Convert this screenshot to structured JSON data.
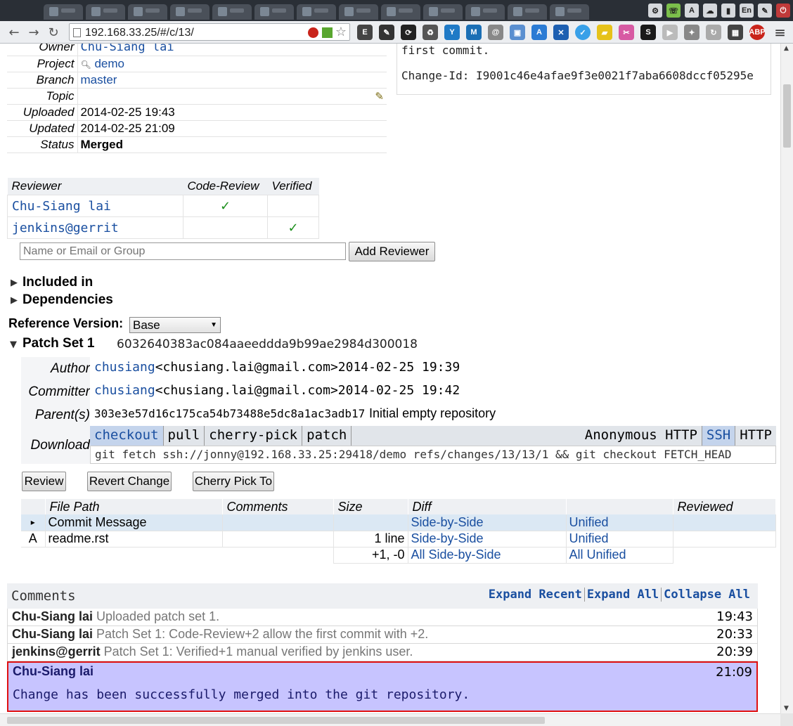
{
  "browser": {
    "url": "192.168.33.25/#/c/13/",
    "tray_labels": [
      "A",
      "En"
    ]
  },
  "change_info": {
    "rows": [
      {
        "label": "Owner",
        "value": "Chu-Siang lai",
        "link": true,
        "mono": true
      },
      {
        "label": "Project",
        "value": "demo",
        "link": true,
        "mono": false,
        "search_icon": true
      },
      {
        "label": "Branch",
        "value": "master",
        "link": true,
        "mono": false
      },
      {
        "label": "Topic",
        "value": "",
        "link": false,
        "mono": false,
        "edit_icon": true
      },
      {
        "label": "Uploaded",
        "value": "2014-02-25 19:43",
        "link": false,
        "mono": false
      },
      {
        "label": "Updated",
        "value": "2014-02-25 21:09",
        "link": false,
        "mono": false
      },
      {
        "label": "Status",
        "value": "Merged",
        "link": false,
        "mono": false,
        "bold": true
      }
    ]
  },
  "commit_message": {
    "first_line": "first commit.",
    "change_id": "Change-Id: I9001c46e4afae9f3e0021f7aba6608dccf05295e"
  },
  "reviewers": {
    "headers": [
      "Reviewer",
      "Code-Review",
      "Verified"
    ],
    "rows": [
      {
        "name": "Chu-Siang lai",
        "code_review": "✓",
        "verified": ""
      },
      {
        "name": "jenkins@gerrit",
        "code_review": "",
        "verified": "✓"
      }
    ],
    "input_placeholder": "Name or Email or Group",
    "add_button": "Add Reviewer"
  },
  "sections": {
    "included_in": "Included in",
    "dependencies": "Dependencies",
    "reference_version_label": "Reference Version:",
    "reference_version_value": "Base"
  },
  "patch_set": {
    "title": "Patch Set 1",
    "revision": "6032640383ac084aaeeddda9b99ae2984d300018",
    "author_label": "Author",
    "author_name": "chusiang",
    "author_email": "<chusiang.lai@gmail.com>",
    "author_date": "2014-02-25 19:39",
    "committer_label": "Committer",
    "committer_name": "chusiang",
    "committer_email": "<chusiang.lai@gmail.com>",
    "committer_date": "2014-02-25 19:42",
    "parent_label": "Parent(s)",
    "parent_hash": "303e3e57d16c175ca54b73488e5dc8a1ac3adb17",
    "parent_subject": "Initial empty repository",
    "download_label": "Download",
    "download_tabs": [
      "checkout",
      "pull",
      "cherry-pick",
      "patch"
    ],
    "transport_tabs": [
      "Anonymous HTTP",
      "SSH",
      "HTTP"
    ],
    "download_command": "git fetch ssh://jonny@192.168.33.25:29418/demo refs/changes/13/13/1 && git checkout FETCH_HEAD",
    "actions": [
      "Review",
      "Revert Change",
      "Cherry Pick To"
    ]
  },
  "files": {
    "headers": [
      "File Path",
      "Comments",
      "Size",
      "Diff",
      "",
      "Reviewed"
    ],
    "rows": [
      {
        "mark": "▸",
        "path": "Commit Message",
        "comments": "",
        "size": "",
        "sbs": "Side-by-Side",
        "unified": "Unified"
      },
      {
        "mark": "A",
        "path": "readme.rst",
        "comments": "",
        "size": "1 line",
        "sbs": "Side-by-Side",
        "unified": "Unified"
      }
    ],
    "totals": {
      "size": "+1, -0",
      "sbs": "All Side-by-Side",
      "unified": "All Unified"
    }
  },
  "comments": {
    "title": "Comments",
    "actions": [
      "Expand Recent",
      "Expand All",
      "Collapse All"
    ],
    "items": [
      {
        "author": "Chu-Siang lai",
        "summary": "Uploaded patch set 1.",
        "time": "19:43"
      },
      {
        "author": "Chu-Siang lai",
        "summary": "Patch Set 1: Code-Review+2 allow the first commit with +2.",
        "time": "20:33"
      },
      {
        "author": "jenkins@gerrit",
        "summary": "Patch Set 1: Verified+1 manual verified by jenkins user.",
        "time": "20:39"
      }
    ],
    "expanded": {
      "author": "Chu-Siang lai",
      "time": "21:09",
      "message": "Change has been successfully merged into the git repository."
    }
  }
}
